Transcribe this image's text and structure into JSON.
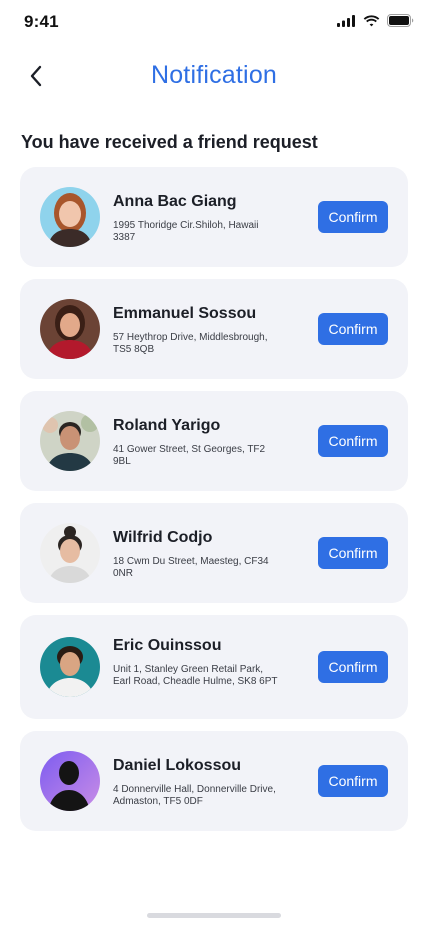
{
  "status_bar": {
    "time": "9:41"
  },
  "header": {
    "title": "Notification",
    "back_icon": "chevron-left-icon"
  },
  "section": {
    "title": "You have received a friend request"
  },
  "colors": {
    "accent": "#2f6fe4",
    "card_bg": "#f2f3f8"
  },
  "requests": [
    {
      "name": "Anna Bac Giang",
      "address": "1995 Thoridge Cir.Shiloh, Hawaii 3387",
      "action": "Confirm"
    },
    {
      "name": "Emmanuel Sossou",
      "address": "57 Heythrop Drive, Middlesbrough, TS5 8QB",
      "action": "Confirm"
    },
    {
      "name": "Roland Yarigo",
      "address": "41 Gower Street, St Georges, TF2 9BL",
      "action": "Confirm"
    },
    {
      "name": "Wilfrid Codjo",
      "address": "18 Cwm Du Street, Maesteg, CF34 0NR",
      "action": "Confirm"
    },
    {
      "name": "Eric Ouinssou",
      "address": "Unit 1, Stanley Green Retail Park, Earl Road, Cheadle Hulme, SK8 6PT",
      "action": "Confirm"
    },
    {
      "name": "Daniel Lokossou",
      "address": "4 Donnerville Hall, Donnerville Drive, Admaston, TF5 0DF",
      "action": "Confirm"
    }
  ]
}
